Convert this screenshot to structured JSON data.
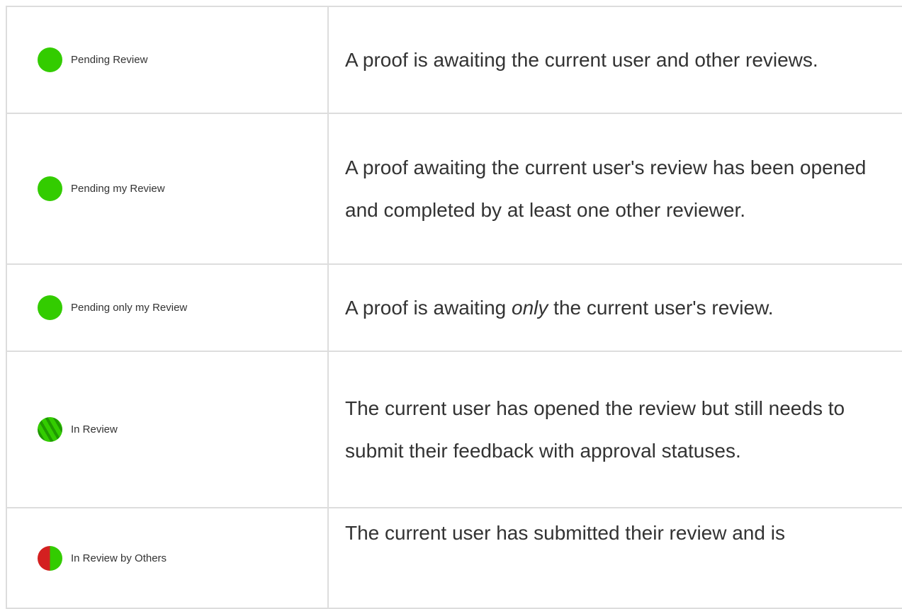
{
  "rows": [
    {
      "status_label": "Pending Review",
      "icon": "solid-green-circle-icon",
      "description": "A proof is awaiting the current user and other reviews."
    },
    {
      "status_label": "Pending my Review",
      "icon": "solid-green-circle-icon",
      "description": "A proof awaiting the current user's review has been opened and completed by at least one other reviewer."
    },
    {
      "status_label": "Pending only my Review",
      "icon": "solid-green-circle-icon",
      "description_before": "A proof is awaiting ",
      "description_emphasis": "only",
      "description_after": " the current user's review."
    },
    {
      "status_label": "In Review",
      "icon": "striped-green-circle-icon",
      "description": "The current user has opened the review but still needs to submit their feedback with approval statuses."
    },
    {
      "status_label": "In Review by Others",
      "icon": "red-green-split-circle-icon",
      "description": "The current user has submitted their review and is"
    }
  ],
  "colors": {
    "green": "#33cc00",
    "dark_green_stripe": "#1f9a00",
    "red": "#d42020",
    "border": "#dddddd",
    "text": "#333333"
  }
}
